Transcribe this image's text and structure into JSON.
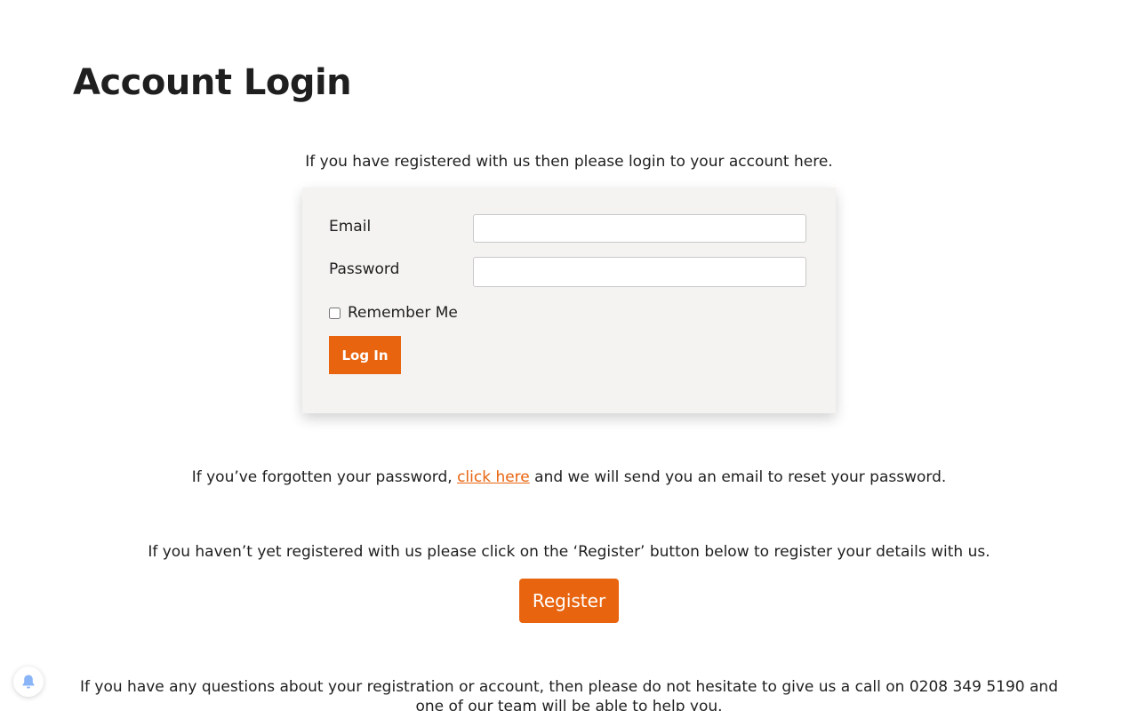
{
  "page": {
    "title": "Account Login",
    "intro": "If you have registered with us then please login to your account here."
  },
  "login_form": {
    "email_label": "Email",
    "email_value": "",
    "password_label": "Password",
    "password_value": "",
    "remember_label": "Remember Me",
    "remember_checked": false,
    "login_button": "Log In"
  },
  "forgot": {
    "before": "If you’ve forgotten your password, ",
    "link": "click here",
    "after": " and we will send you an email to reset your password."
  },
  "register": {
    "info": "If you haven’t yet registered with us please click on the ‘Register’ button below to register your details with us.",
    "button": "Register"
  },
  "footer": {
    "questions": "If you have any questions about your registration or account, then please do not hesitate to give us a call on 0208 349 5190 and one of our team will be able to help you."
  },
  "notification_widget": {
    "icon": "bell-icon"
  },
  "colors": {
    "accent": "#e8640f",
    "form_background": "#f4f3f1",
    "bell": "#8ab4f8"
  }
}
